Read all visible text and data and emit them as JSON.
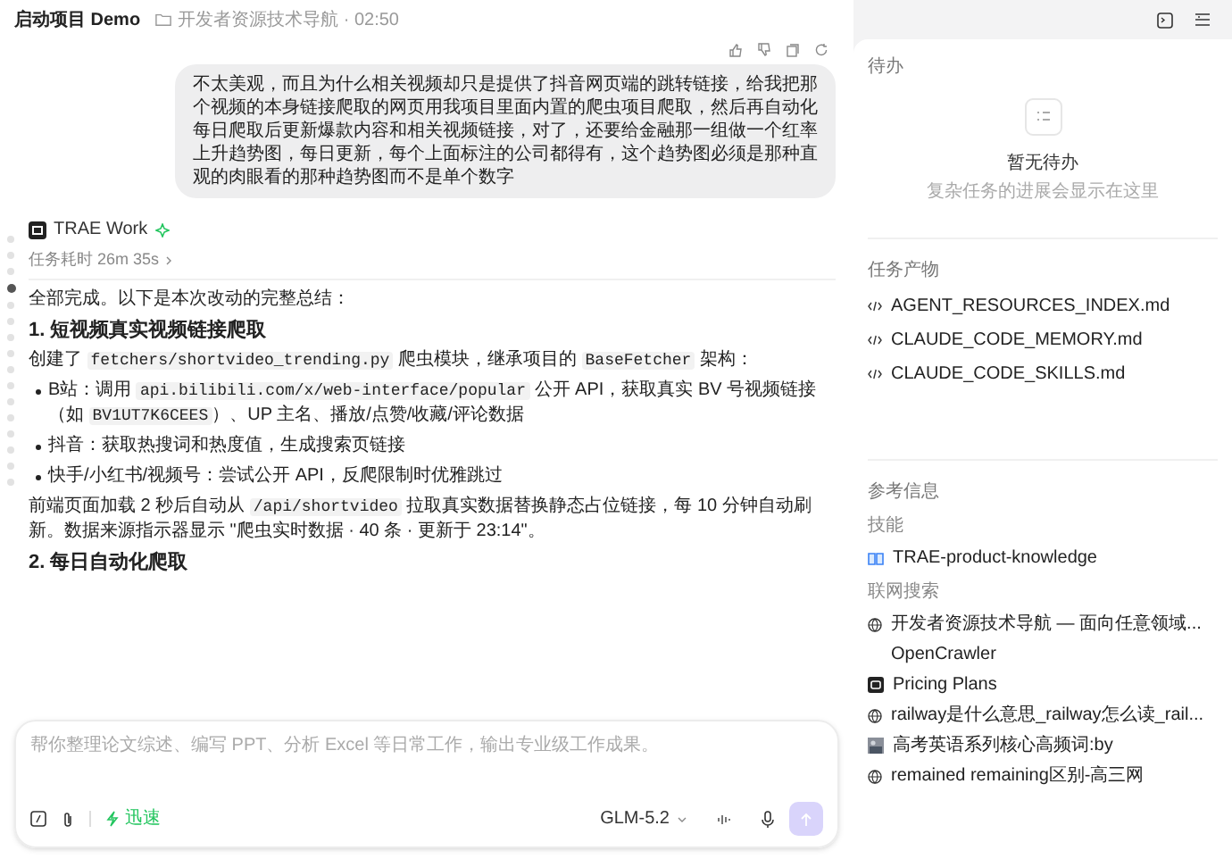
{
  "header": {
    "project": "启动项目 Demo",
    "folder": "开发者资源技术导航 · 02:50"
  },
  "user_message": "不太美观，而且为什么相关视频却只是提供了抖音网页端的跳转链接，给我把那个视频的本身链接爬取的网页用我项目里面内置的爬虫项目爬取，然后再自动化每日爬取后更新爆款内容和相关视频链接，对了，还要给金融那一组做一个红率上升趋势图，每日更新，每个上面标注的公司都得有，这个趋势图必须是那种直观的肉眼看的那种趋势图而不是单个数字",
  "timeline_dots": [
    {
      "selected": false
    },
    {
      "selected": false
    },
    {
      "selected": false
    },
    {
      "selected": true
    },
    {
      "selected": false
    },
    {
      "selected": false
    },
    {
      "selected": false
    },
    {
      "selected": false
    },
    {
      "selected": false
    },
    {
      "selected": false
    },
    {
      "selected": false
    },
    {
      "selected": false
    },
    {
      "selected": false
    },
    {
      "selected": false
    },
    {
      "selected": false
    },
    {
      "selected": false
    }
  ],
  "agent": {
    "name": "TRAE Work",
    "duration": "任务耗时 26m 35s"
  },
  "blocks": [
    {
      "kind": "para",
      "text": "全部完成。以下是本次改动的完整总结："
    },
    {
      "kind": "heading",
      "text": "1. 短视频真实视频链接爬取"
    },
    {
      "kind": "para",
      "parts": [
        {
          "text": "创建了 "
        },
        {
          "code": "fetchers/shortvideo_trending.py"
        },
        {
          "text": " 爬虫模块，继承项目的 "
        },
        {
          "code": "BaseFetcher"
        },
        {
          "text": " 架构："
        }
      ]
    },
    {
      "kind": "bullet",
      "parts": [
        {
          "text": "B站：调用 "
        },
        {
          "code": "api.bilibili.com/x/web-interface/popular"
        },
        {
          "text": " 公开 API，获取真实 BV 号视频链接（如 "
        },
        {
          "code": "BV1UT7K6CEES"
        },
        {
          "text": "）、UP 主名、播放/点赞/收藏/评论数据"
        }
      ]
    },
    {
      "kind": "bullet",
      "parts": [
        {
          "text": "抖音：获取热搜词和热度值，生成搜索页链接"
        }
      ]
    },
    {
      "kind": "bullet",
      "parts": [
        {
          "text": "快手/小红书/视频号：尝试公开 API，反爬限制时优雅跳过"
        }
      ]
    },
    {
      "kind": "para",
      "parts": [
        {
          "text": "前端页面加载 2 秒后自动从 "
        },
        {
          "code": "/api/shortvideo"
        },
        {
          "text": " 拉取真实数据替换静态占位链接，每 10 分钟自动刷新。数据来源指示器显示 \"爬虫实时数据 · 40 条 · 更新于 23:14\"。"
        }
      ]
    },
    {
      "kind": "heading",
      "text": "2. 每日自动化爬取"
    }
  ],
  "composer": {
    "placeholder": "帮你整理论文综述、编写 PPT、分析 Excel 等日常工作，输出专业级工作成果。",
    "mode": "迅速",
    "model": "GLM-5.2"
  },
  "todo": {
    "title": "待办",
    "empty_title": "暂无待办",
    "empty_hint": "复杂任务的进展会显示在这里"
  },
  "artifacts": {
    "title": "任务产物",
    "items": [
      "AGENT_RESOURCES_INDEX.md",
      "CLAUDE_CODE_MEMORY.md",
      "CLAUDE_CODE_SKILLS.md"
    ]
  },
  "references": {
    "title": "参考信息",
    "skills_title": "技能",
    "skills": [
      "TRAE-product-knowledge"
    ],
    "search_title": "联网搜索",
    "results": [
      {
        "kind": "web",
        "title": "开发者资源技术导航 — 面向任意领域..."
      },
      {
        "kind": "plain",
        "title": "OpenCrawler"
      },
      {
        "kind": "app",
        "title": "Pricing Plans"
      },
      {
        "kind": "web",
        "title": "railway是什么意思_railway怎么读_rail..."
      },
      {
        "kind": "thumb",
        "title": "高考英语系列核心高频词:by"
      },
      {
        "kind": "web",
        "title": "remained remaining区别-高三网"
      }
    ]
  }
}
